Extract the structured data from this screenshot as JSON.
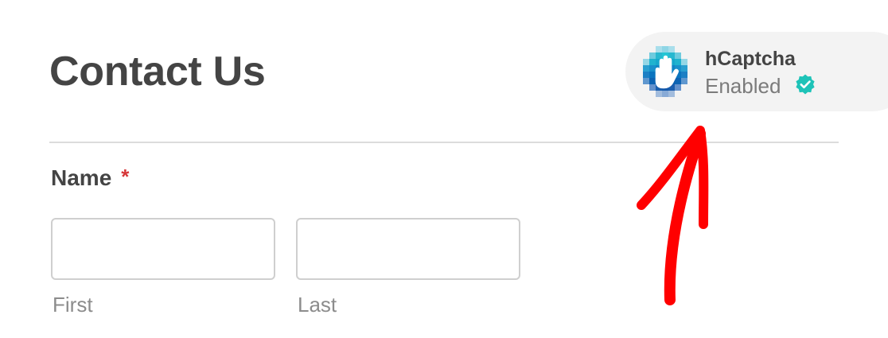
{
  "form": {
    "title": "Contact Us",
    "name_field": {
      "label": "Name",
      "required_mark": "*",
      "first": {
        "value": "",
        "placeholder": "",
        "sublabel": "First"
      },
      "last": {
        "value": "",
        "placeholder": "",
        "sublabel": "Last"
      }
    }
  },
  "captcha_badge": {
    "name": "hCaptcha",
    "status": "Enabled",
    "logo_icon": "hcaptcha-hand-logo-icon",
    "status_icon": "verified-check-icon"
  },
  "annotation": {
    "icon": "red-arrow-pointing-up",
    "color": "#ff0000"
  },
  "colors": {
    "required": "#d63638",
    "badge_background": "#f3f3f3",
    "verified": "#1ec3b8",
    "hcaptcha_blue": "#0074bf",
    "hcaptcha_teal": "#22c5d4"
  }
}
